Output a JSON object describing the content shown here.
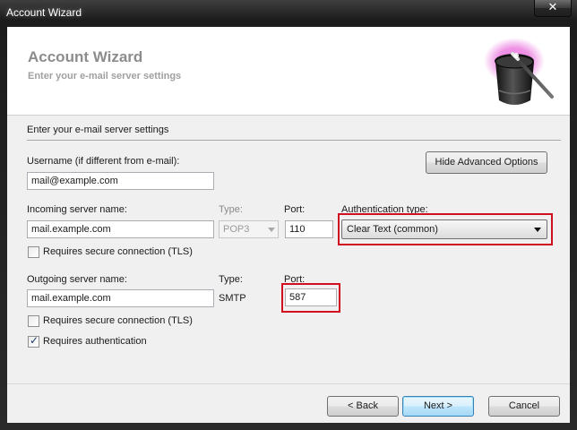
{
  "window": {
    "title": "Account Wizard",
    "close_glyph": "✕"
  },
  "header": {
    "title": "Account Wizard",
    "subtitle": "Enter your e-mail server settings",
    "icon": "wizard-hat-icon"
  },
  "section": {
    "title": "Enter your e-mail server settings"
  },
  "username": {
    "label": "Username (if different from e-mail):",
    "value": "mail@example.com"
  },
  "advanced_button": {
    "label": "Hide Advanced Options"
  },
  "incoming": {
    "server_label": "Incoming server name:",
    "server_value": "mail.example.com",
    "type_label": "Type:",
    "type_value": "POP3",
    "port_label": "Port:",
    "port_value": "110",
    "auth_label": "Authentication type:",
    "auth_value": "Clear Text (common)",
    "secure_label": "Requires secure connection (TLS)",
    "secure_checked": false
  },
  "outgoing": {
    "server_label": "Outgoing server name:",
    "server_value": "mail.example.com",
    "type_label": "Type:",
    "type_value": "SMTP",
    "port_label": "Port:",
    "port_value": "587",
    "secure_label": "Requires secure connection (TLS)",
    "secure_checked": false,
    "auth_required_label": "Requires authentication",
    "auth_required_checked": true
  },
  "footer": {
    "back_label": "< Back",
    "next_label": "Next >",
    "cancel_label": "Cancel"
  },
  "colors": {
    "highlight": "#d0101f",
    "header_text": "#8c8c8c",
    "dialog_bg": "#f0f0f0"
  }
}
